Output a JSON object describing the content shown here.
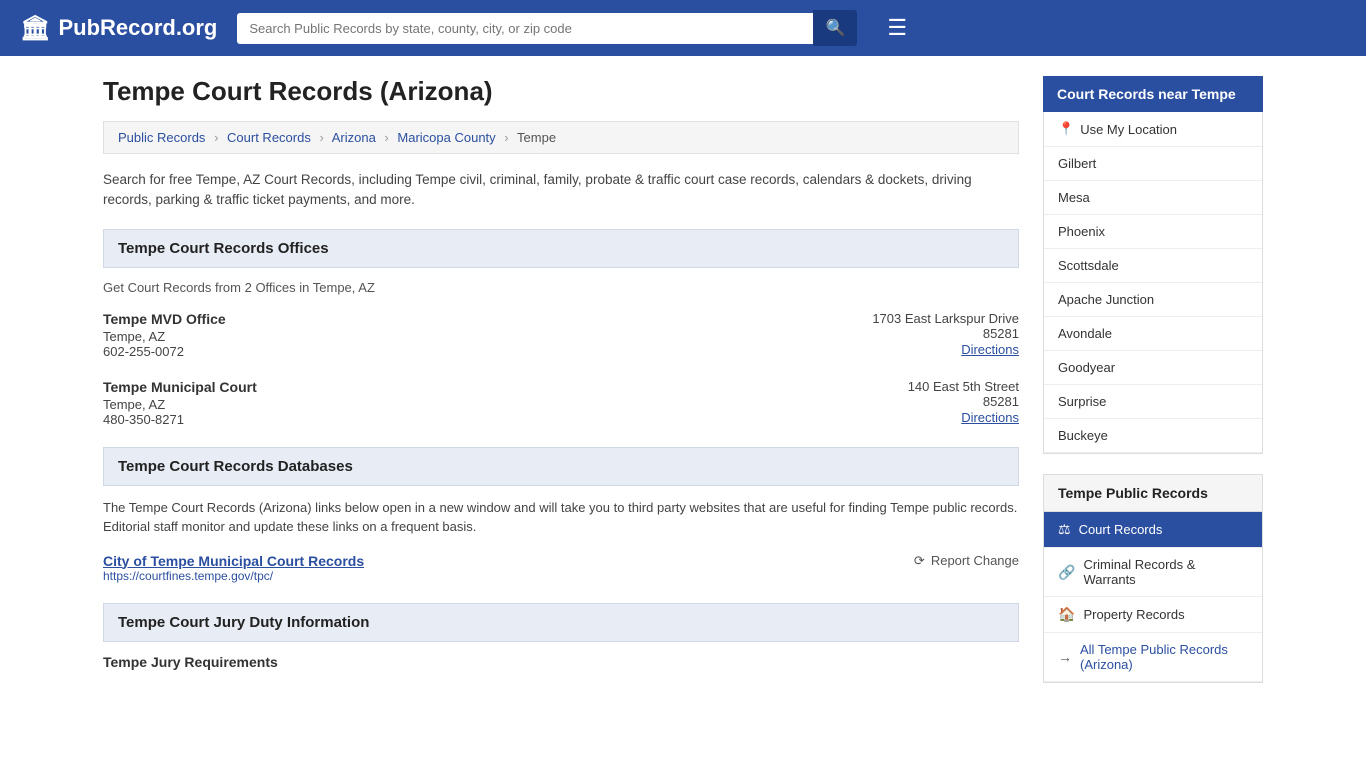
{
  "header": {
    "logo_text": "PubRecord.org",
    "search_placeholder": "Search Public Records by state, county, city, or zip code"
  },
  "page": {
    "title": "Tempe Court Records (Arizona)",
    "intro": "Search for free Tempe, AZ Court Records, including Tempe civil, criminal, family, probate & traffic court case records, calendars & dockets, driving records, parking & traffic ticket payments, and more."
  },
  "breadcrumb": {
    "items": [
      "Public Records",
      "Court Records",
      "Arizona",
      "Maricopa County",
      "Tempe"
    ]
  },
  "offices_section": {
    "header": "Tempe Court Records Offices",
    "subtext": "Get Court Records from 2 Offices in Tempe, AZ",
    "offices": [
      {
        "name": "Tempe MVD Office",
        "city": "Tempe, AZ",
        "phone": "602-255-0072",
        "address": "1703 East Larkspur Drive",
        "zip": "85281",
        "directions_label": "Directions"
      },
      {
        "name": "Tempe Municipal Court",
        "city": "Tempe, AZ",
        "phone": "480-350-8271",
        "address": "140 East 5th Street",
        "zip": "85281",
        "directions_label": "Directions"
      }
    ]
  },
  "databases_section": {
    "header": "Tempe Court Records Databases",
    "intro": "The Tempe Court Records (Arizona) links below open in a new window and will take you to third party websites that are useful for finding Tempe public records. Editorial staff monitor and update these links on a frequent basis.",
    "entries": [
      {
        "name": "City of Tempe Municipal Court Records",
        "url": "https://courtfines.tempe.gov/tpc/",
        "report_change_label": "Report Change"
      }
    ]
  },
  "jury_section": {
    "header": "Tempe Court Jury Duty Information",
    "sub_header": "Tempe Jury Requirements"
  },
  "sidebar_near": {
    "title": "Court Records near Tempe",
    "use_location": "Use My Location",
    "cities": [
      "Gilbert",
      "Mesa",
      "Phoenix",
      "Scottsdale",
      "Apache Junction",
      "Avondale",
      "Goodyear",
      "Surprise",
      "Buckeye"
    ]
  },
  "sidebar_public_records": {
    "title": "Tempe Public Records",
    "items": [
      {
        "label": "Court Records",
        "icon": "⚖",
        "active": true
      },
      {
        "label": "Criminal Records & Warrants",
        "icon": "🔗",
        "active": false
      },
      {
        "label": "Property Records",
        "icon": "🏠",
        "active": false
      },
      {
        "label": "All Tempe Public Records (Arizona)",
        "icon": "→",
        "active": false,
        "is_all": true
      }
    ]
  }
}
